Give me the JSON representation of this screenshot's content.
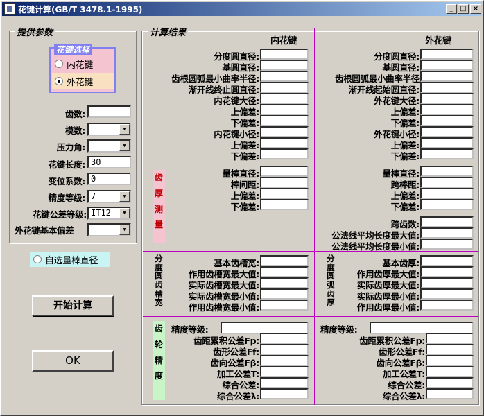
{
  "window": {
    "title": "花键计算(GB/T 3478.1-1995)",
    "min": "_",
    "max": "□",
    "close": "×"
  },
  "left": {
    "group_title": "提供参数",
    "spline_select": {
      "title": "花键选择",
      "opt_inner": "内花键",
      "opt_outer": "外花键",
      "selected": "外花键"
    },
    "teeth_label": "齿数:",
    "teeth_value": "",
    "module_label": "模数:",
    "module_value": "",
    "pressure_label": "压力角:",
    "pressure_value": "",
    "length_label": "花键长度:",
    "length_value": "30",
    "shift_label": "变位系数:",
    "shift_value": "0",
    "grade_label": "精度等级:",
    "grade_value": "7",
    "tol_grade_label": "花键公差等级:",
    "tol_grade_value": "IT12",
    "basic_dev_label": "外花键基本偏差",
    "basic_dev_value": "",
    "self_select_label": "自选量棒直径",
    "start_button": "开始计算",
    "ok_button": "OK"
  },
  "result": {
    "group_title": "计算结果",
    "inner_header": "内花键",
    "outer_header": "外花键",
    "inner_rows": [
      "分度圆直径:",
      "基圆直径:",
      "齿根圆弧最小曲率半径:",
      "渐开线终止圆直径:",
      "内花键大径:",
      "上偏差:",
      "下偏差:",
      "内花键小径:",
      "上偏差:",
      "下偏差:"
    ],
    "outer_rows": [
      "分度圆直径:",
      "基圆直径:",
      "齿根圆弧最小曲率半径",
      "渐开线起始圆直径:",
      "外花键大径:",
      "上偏差:",
      "下偏差:",
      "外花键小径:",
      "上偏差:",
      "下偏差:"
    ],
    "thick_section": "齿厚测量",
    "inner_meas": [
      "量棒直径:",
      "棒间距:",
      "上偏差:",
      "下偏差:"
    ],
    "outer_meas": [
      "量棒直径:",
      "跨棒距:",
      "上偏差:",
      "下偏差:"
    ],
    "outer_span": [
      "跨齿数:",
      "公法线平均长度最大值:",
      "公法线平均长度最小值:"
    ],
    "space_section": "分度圆齿槽宽",
    "inner_space": [
      "基本齿槽宽:",
      "作用齿槽宽最大值:",
      "实际齿槽宽最大值:",
      "实际齿槽宽最小值:",
      "作用齿槽宽最小值:"
    ],
    "arc_section": "分度圆弧齿厚",
    "outer_space": [
      "基本齿厚:",
      "作用齿厚最大值:",
      "实际齿厚最大值:",
      "实际齿厚最小值:",
      "作用齿厚最小值:"
    ],
    "gear_section": "齿轮精度",
    "grade_label": "精度等级:",
    "gear_rows": [
      "齿距累积公差Fp:",
      "齿形公差Ff:",
      "齿向公差Fβ:",
      "加工公差T:",
      "综合公差:",
      "综合公差λ:"
    ]
  }
}
